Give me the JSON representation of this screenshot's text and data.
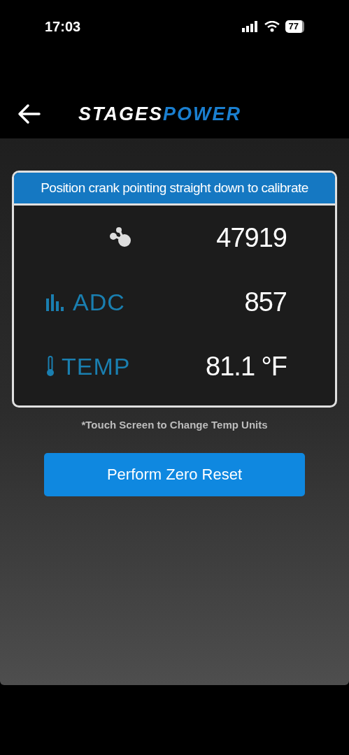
{
  "status_bar": {
    "time": "17:03",
    "battery": "77"
  },
  "header": {
    "logo": {
      "first": "STAGES",
      "second": "POWER"
    }
  },
  "panel": {
    "title": "Position crank pointing straight down to calibrate",
    "rows": [
      {
        "kind": "node",
        "value": "47919"
      },
      {
        "kind": "bars",
        "label": "ADC",
        "value": "857"
      },
      {
        "kind": "thermometer",
        "label": "TEMP",
        "value": "81.1 °F"
      }
    ]
  },
  "note": "*Touch Screen to Change Temp Units",
  "button": "Perform Zero Reset"
}
